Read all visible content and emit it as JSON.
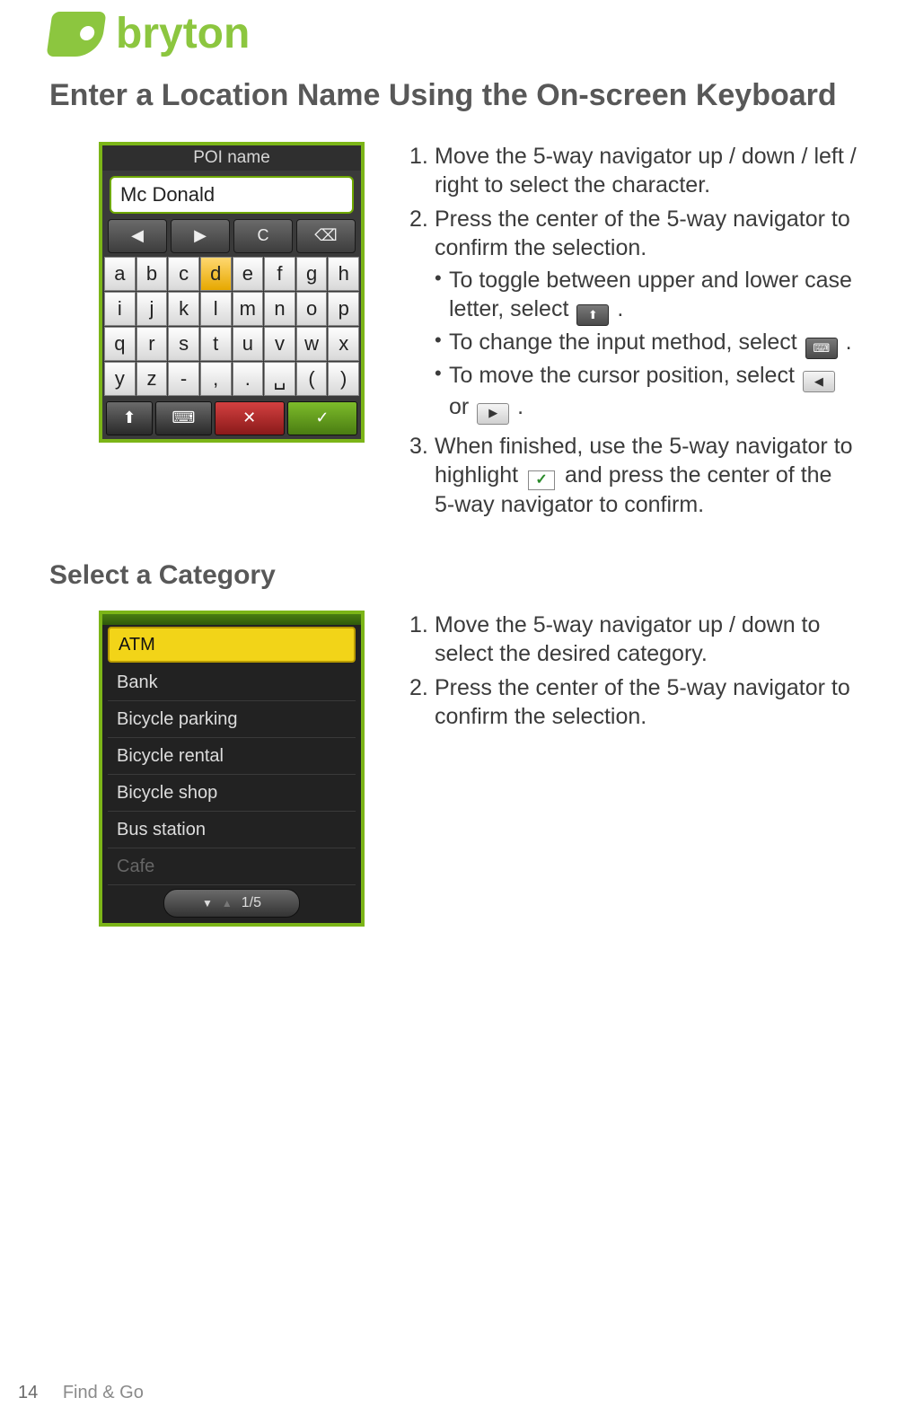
{
  "brand": {
    "name": "bryton"
  },
  "section1": {
    "title": "Enter a Location Name Using the On-screen Keyboard",
    "poi": {
      "title": "POI name",
      "input_value": "Mc Donald",
      "nav_buttons": {
        "left": "◀",
        "right": "▶",
        "clear": "C",
        "backspace": "⌫"
      },
      "keys_row1": [
        "a",
        "b",
        "c",
        "d",
        "e",
        "f",
        "g",
        "h"
      ],
      "keys_row2": [
        "i",
        "j",
        "k",
        "l",
        "m",
        "n",
        "o",
        "p"
      ],
      "keys_row3": [
        "q",
        "r",
        "s",
        "t",
        "u",
        "v",
        "w",
        "x"
      ],
      "keys_row4": [
        "y",
        "z",
        "-",
        ",",
        ".",
        "␣",
        "(",
        ")"
      ],
      "selected_key": "d",
      "bottom": {
        "shift": "⬆",
        "ime": "⌨",
        "cancel": "✕",
        "ok": "✓"
      }
    },
    "steps": {
      "s1": "Move the 5-way navigator up / down / left / right to select the character.",
      "s2": "Press the center of the 5-way navigator to confirm the selection.",
      "b1a": "To toggle between upper and lower case letter, select ",
      "b1b": ".",
      "b2a": "To change the input method, select ",
      "b2b": ".",
      "b3a": "To move the cursor position, select ",
      "b3_or": " or ",
      "b3b": ".",
      "s3a": "When finished, use the 5-way navigator to highlight ",
      "s3b": " and press the center of the 5-way navigator to confirm."
    },
    "inline_icons": {
      "shift": "⬆",
      "ime": "⌨",
      "left": "◀",
      "right": "▶",
      "check": "✓"
    }
  },
  "section2": {
    "title": "Select a Category",
    "cat": {
      "items": [
        "ATM",
        "Bank",
        "Bicycle parking",
        "Bicycle rental",
        "Bicycle shop",
        "Bus station",
        "Cafe"
      ],
      "selected_index": 0,
      "pager": {
        "down": "▼",
        "up": "▲",
        "label": "1/5"
      }
    },
    "steps": {
      "s1": "Move the 5-way navigator up / down to select the desired category.",
      "s2": "Press the center of the 5-way navigator to confirm the selection."
    }
  },
  "footer": {
    "page": "14",
    "breadcrumb": "Find & Go"
  }
}
